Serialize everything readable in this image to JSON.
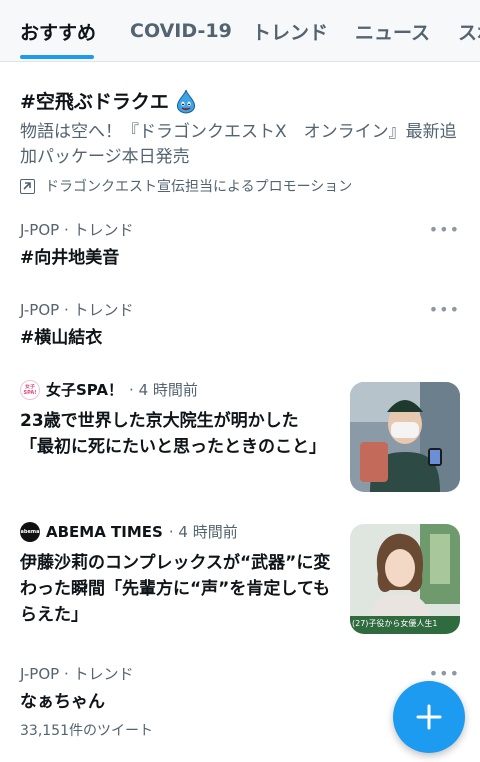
{
  "tabs": [
    {
      "label": "おすすめ",
      "active": true
    },
    {
      "label": "COVID-19",
      "active": false
    },
    {
      "label": "トレンド",
      "active": false
    },
    {
      "label": "ニュース",
      "active": false
    },
    {
      "label": "スポ",
      "active": false
    }
  ],
  "promo": {
    "title": "#空飛ぶドラクエ",
    "description": "物語は空へ！『ドラゴンクエストX　オンライン』最新追加パッケージ本日発売",
    "promoted_by": "ドラゴンクエスト宣伝担当によるプロモーション"
  },
  "trends": [
    {
      "category": "J-POP · トレンド",
      "name": "#向井地美音",
      "count": ""
    },
    {
      "category": "J-POP · トレンド",
      "name": "#横山結衣",
      "count": ""
    },
    {
      "category": "J-POP · トレンド",
      "name": "なぁちゃん",
      "count": "33,151件のツイート"
    }
  ],
  "news": [
    {
      "source": "女子SPA！",
      "logo_text": "女子SPA!",
      "time": "· 4 時間前",
      "title": "23歳で世界した京大院生が明かした「最初に死にたいと思ったときのこと」"
    },
    {
      "source": "ABEMA TIMES",
      "logo_text": "abema",
      "time": "· 4 時間前",
      "title": "伊藤沙莉のコンプレックスが“武器”に変わった瞬間「先輩方に“声”を肯定してもらえた」",
      "thumb_caption": "(27)子役から女優人生1"
    }
  ],
  "more_label": "•••",
  "colors": {
    "accent": "#1d9bf0",
    "text": "#0f1419",
    "muted": "#536471"
  }
}
